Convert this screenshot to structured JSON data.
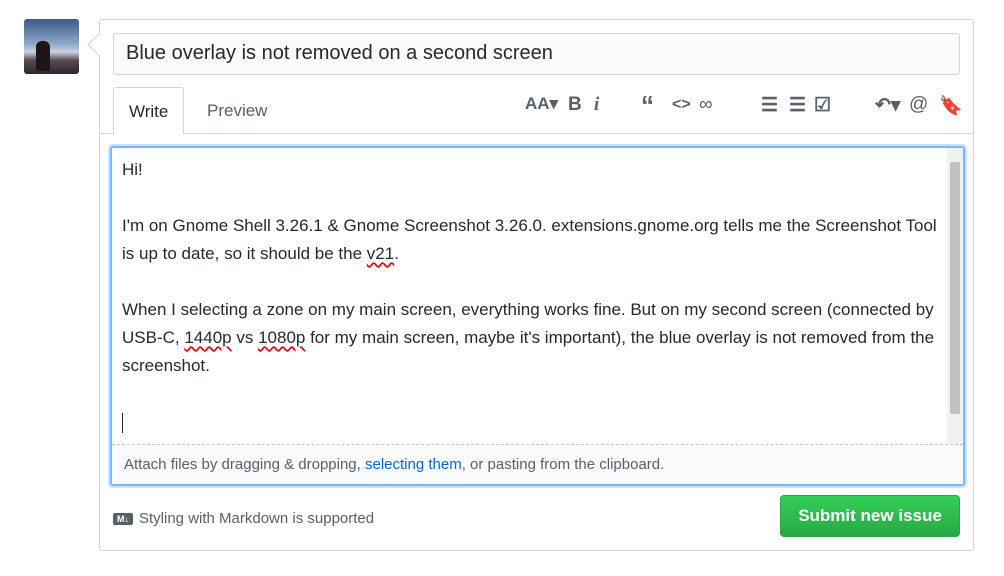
{
  "issue": {
    "title": "Blue overlay is not removed on a second screen"
  },
  "tabs": [
    {
      "label": "Write",
      "active": true
    },
    {
      "label": "Preview",
      "active": false
    }
  ],
  "toolbar": [
    "text-size-icon",
    "bold-icon",
    "italic-icon",
    "quote-icon",
    "code-icon",
    "link-icon",
    "unordered-list-icon",
    "ordered-list-icon",
    "task-list-icon",
    "reply-icon",
    "mention-icon",
    "saved-reply-icon"
  ],
  "body": {
    "p1": "Hi!",
    "p2a": "I'm on Gnome Shell 3.26.1 & Gnome Screenshot 3.26.0. extensions.gnome.org tells me the Screenshot Tool is up to date, so it should be the ",
    "p2b": "v21",
    "p2c": ".",
    "p3a": "When I selecting a zone on my main screen, everything works fine. But on my second screen (connected by USB-C, ",
    "p3b": "1440p",
    "p3c": " vs ",
    "p3d": "1080p",
    "p3e": " for my main screen, maybe it's important), the blue overlay is not removed from the screenshot."
  },
  "attach": {
    "before": "Attach files by dragging & dropping, ",
    "link": "selecting them",
    "after": ", or pasting from the clipboard."
  },
  "markdown": {
    "icon": "markdown-icon",
    "label": "Styling with Markdown is supported"
  },
  "submit": {
    "label": "Submit new issue",
    "color": "#28a745"
  }
}
